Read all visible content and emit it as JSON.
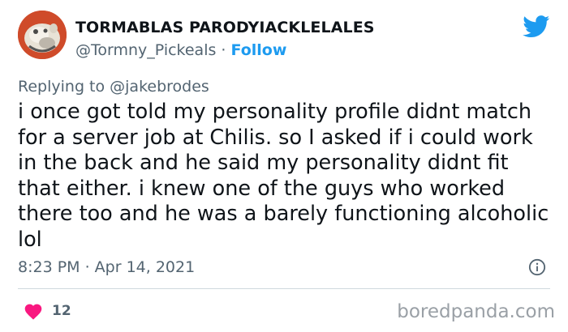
{
  "author": {
    "display_name": "TORMABLAS PARODYIACKLELALES",
    "handle": "@Tormny_Pickeals",
    "separator": " · ",
    "follow_label": "Follow"
  },
  "reply": {
    "prefix": "Replying to ",
    "mention": "@jakebrodes"
  },
  "tweet": {
    "lines": [
      "i once got told my personality profile didnt match",
      "for a server job at Chilis. so I asked if i could work",
      "in the back and he said my personality didnt fit",
      "that either. i knew one of the guys who worked",
      "there too and he was a barely functioning alcoholic",
      "lol"
    ],
    "timestamp": "8:23 PM · Apr 14, 2021",
    "likes": "12"
  },
  "icons": {
    "platform": "twitter-bird-icon",
    "info": "info-icon",
    "like": "heart-icon"
  },
  "colors": {
    "accent": "#1d9bf0",
    "like": "#f91880",
    "secondary_text": "#536471"
  },
  "watermark": "boredpanda.com"
}
